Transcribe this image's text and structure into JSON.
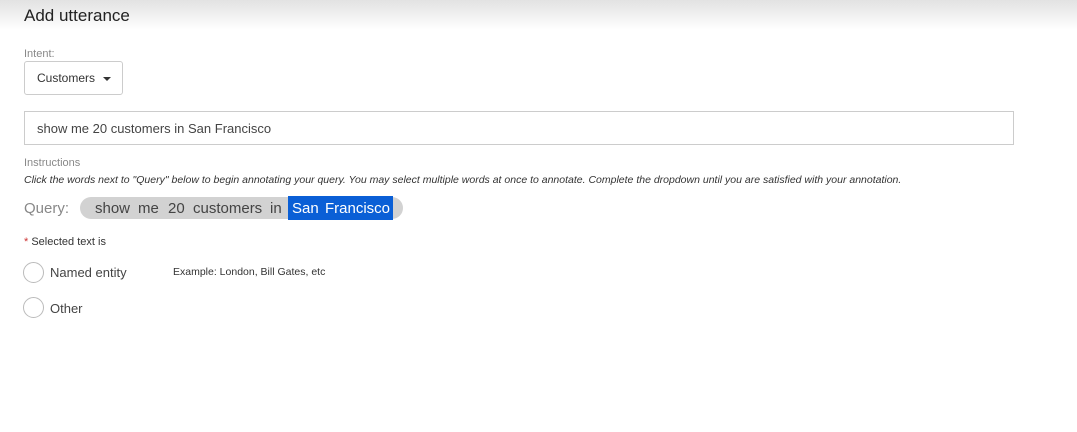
{
  "title": "Add utterance",
  "intent": {
    "label": "Intent:",
    "selected": "Customers"
  },
  "utterance": {
    "value": "show me 20 customers in San Francisco"
  },
  "instructions": {
    "heading": "Instructions",
    "text": "Click the words next to \"Query\" below to begin annotating your query. You may select multiple words at once to annotate. Complete the dropdown until you are satisfied with your annotation."
  },
  "query": {
    "label": "Query:",
    "words": [
      "show",
      "me",
      "20",
      "customers",
      "in",
      "San",
      "Francisco"
    ],
    "selected_words": [
      "San",
      "Francisco"
    ]
  },
  "selection": {
    "required_mark": "*",
    "label": "Selected text is",
    "options": [
      {
        "label": "Named entity",
        "example": "Example: London, Bill Gates, etc"
      },
      {
        "label": "Other"
      }
    ]
  },
  "colors": {
    "selection": "#0a5fd6",
    "chip": "#d2d2d2"
  }
}
